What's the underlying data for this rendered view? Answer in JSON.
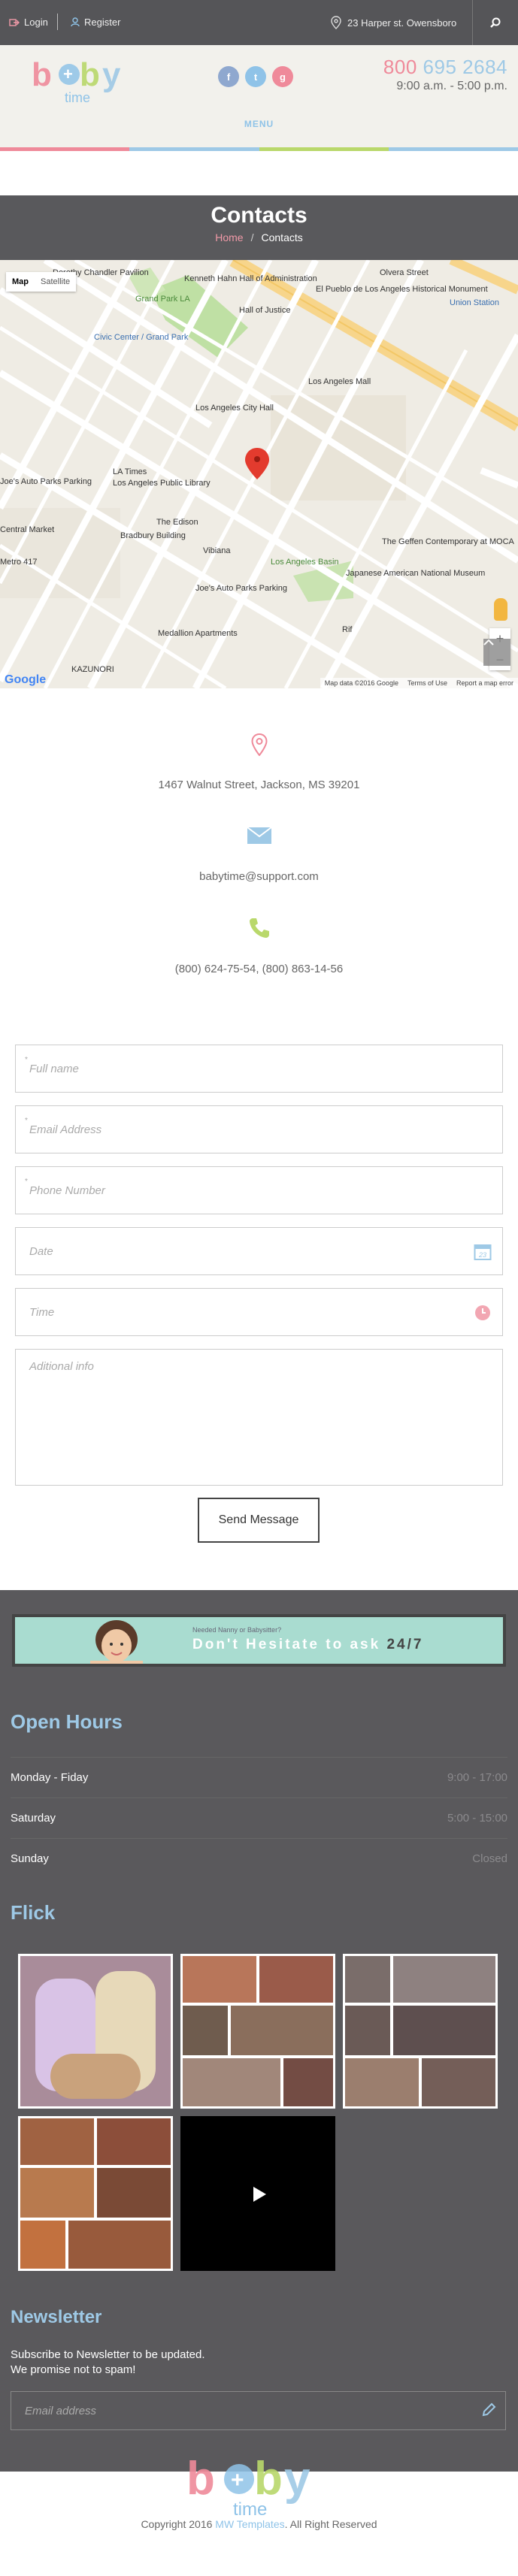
{
  "topbar": {
    "login": "Login",
    "register": "Register",
    "address": "23 Harper st. Owensboro"
  },
  "header": {
    "logo_text": "baby",
    "logo_sub": "time",
    "phone_prefix": "800",
    "phone_rest": "695 2684",
    "hours": "9:00 a.m. - 5:00 p.m.",
    "menu": "MENU",
    "social": [
      "f",
      "t",
      "g"
    ]
  },
  "colors": {
    "pink": "#ef8a9a",
    "blue": "#9ec9e6",
    "green": "#b9d86b",
    "dark": "#59595c"
  },
  "page": {
    "title": "Contacts",
    "breadcrumb_home": "Home",
    "breadcrumb_sep": "/",
    "breadcrumb_current": "Contacts"
  },
  "map": {
    "type_map": "Map",
    "type_satellite": "Satellite",
    "labels": [
      "Kenneth Hahn Hall of Administration",
      "Grand Park LA",
      "Hall of Justice",
      "El Pueblo de Los Angeles Historical Monument",
      "Olvera Street",
      "Union Station",
      "Civic Center / Grand Park",
      "Los Angeles Mall",
      "Los Angeles City Hall",
      "LA Times",
      "Joe's Auto Parks Parking",
      "Los Angeles Public Library",
      "Central Market",
      "The Edison",
      "Bradbury Building",
      "Vibiana",
      "The Geffen Contemporary at MOCA",
      "Japanese American National Museum",
      "Los Angeles Basin",
      "Joe's Auto Parks Parking",
      "Medallion Apartments",
      "Metro 417",
      "KAZUNORI",
      "Rif",
      "Dorothy Chandler Pavilion"
    ],
    "footer_data": "Map data ©2016 Google",
    "footer_terms": "Terms of Use",
    "footer_report": "Report a map error",
    "google": "Google"
  },
  "contact": {
    "address": "1467 Walnut Street, Jackson, MS 39201",
    "email": "babytime@support.com",
    "phones": "(800) 624-75-54, (800) 863-14-56"
  },
  "form": {
    "fullname_placeholder": "Full name",
    "email_placeholder": "Email Address",
    "phone_placeholder": "Phone Number",
    "date_placeholder": "Date",
    "time_placeholder": "Time",
    "info_placeholder": "Aditional info",
    "required_mark": "*",
    "send": "Send Message"
  },
  "banner": {
    "small": "Needed Nanny or Babysitter?",
    "big": "Don't Hesitate to ask",
    "big_accent": "24/7"
  },
  "hours_section": {
    "title": "Open Hours",
    "rows": [
      {
        "day": "Monday - Fiday",
        "time": "9:00 - 17:00"
      },
      {
        "day": "Saturday",
        "time": "5:00 - 15:00"
      },
      {
        "day": "Sunday",
        "time": "Closed"
      }
    ]
  },
  "flick": {
    "title": "Flick"
  },
  "newsletter": {
    "title": "Newsletter",
    "line1": "Subscribe to Newsletter to be updated.",
    "line2": "We promise not to spam!",
    "placeholder": "Email address"
  },
  "footer": {
    "copy_prefix": "Copyright 2016",
    "copy_brand": "MW Templates",
    "copy_suffix": ". All Right Reserved"
  }
}
